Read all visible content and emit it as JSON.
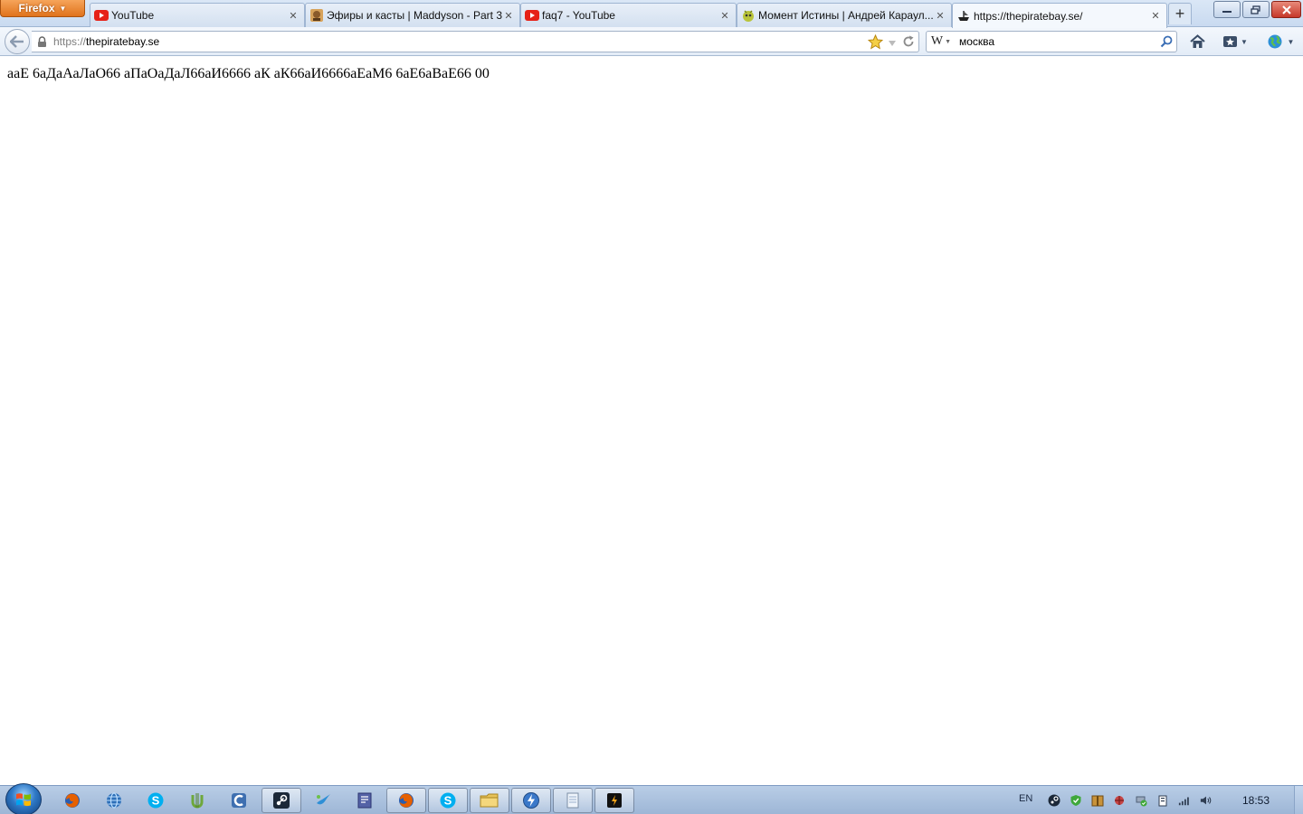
{
  "browser": {
    "app_button_label": "Firefox",
    "tabs": [
      {
        "label": "YouTube",
        "icon": "youtube-icon"
      },
      {
        "label": "Эфиры и касты | Maddyson - Part 3",
        "icon": "maddyson-favicon"
      },
      {
        "label": "faq7 - YouTube",
        "icon": "youtube-icon"
      },
      {
        "label": "Момент Истины | Андрей Караул...",
        "icon": "moment-favicon"
      },
      {
        "label": "https://thepiratebay.se/",
        "icon": "piratebay-favicon",
        "active": true
      }
    ],
    "new_tab_label": "+",
    "url_scheme": "https://",
    "url_host": "thepiratebay.se",
    "search_engine_label": "W",
    "search_value": "москва"
  },
  "page": {
    "body_text": "ааЕ 6аДаАаЛаО66 аПаОаДаЛ66аИ6666 аК аК66аИ6666аЕаМ6 6аЕ6аВаЕ66 00"
  },
  "taskbar": {
    "pinned": [
      {
        "name": "firefox-pinned-icon",
        "running": false
      },
      {
        "name": "network-globe-icon",
        "running": false
      },
      {
        "name": "skype-pinned-icon",
        "running": false
      },
      {
        "name": "utorrent-icon",
        "running": false
      },
      {
        "name": "ccleaner-icon",
        "running": false
      },
      {
        "name": "steam-icon",
        "running": true
      },
      {
        "name": "qip-icon",
        "running": false
      },
      {
        "name": "notepad-plus-icon",
        "running": false
      },
      {
        "name": "firefox-running-icon",
        "running": true
      },
      {
        "name": "skype-running-icon",
        "running": true
      },
      {
        "name": "explorer-folder-icon",
        "running": true
      },
      {
        "name": "speed-dial-icon",
        "running": true
      },
      {
        "name": "notepad-icon",
        "running": true
      },
      {
        "name": "winamp-icon",
        "running": true
      }
    ],
    "language": "EN",
    "clock": "18:53"
  },
  "colors": {
    "firefox_button": "#e0731c",
    "youtube_red": "#e62117",
    "taskbar": "#a9c1df"
  }
}
